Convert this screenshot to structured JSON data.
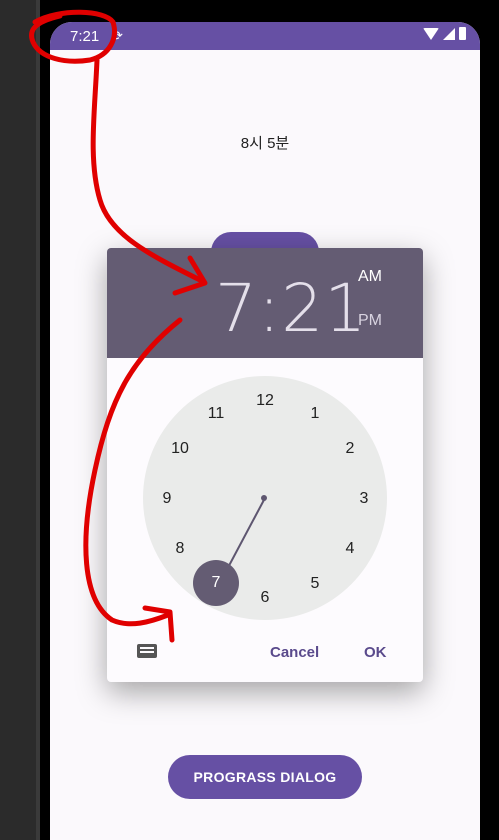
{
  "status_bar": {
    "time": "7:21",
    "sync_icon": "sync-icon",
    "icons": [
      "wifi-icon",
      "cell-signal-icon",
      "battery-icon"
    ]
  },
  "main": {
    "time_text": "8시 5분",
    "progress_button": "PROGRASS DIALOG"
  },
  "time_picker": {
    "display_time": "7:21",
    "am": "AM",
    "pm": "PM",
    "numbers": [
      "12",
      "1",
      "2",
      "3",
      "4",
      "5",
      "6",
      "7",
      "8",
      "9",
      "10",
      "11"
    ],
    "selected_hour": "7",
    "keyboard_icon": "keyboard-icon",
    "cancel": "Cancel",
    "ok": "OK"
  },
  "colors": {
    "primary": "#6650a4",
    "header": "#645c73",
    "clock_face": "#eaebea",
    "annotation": "#e00000"
  }
}
